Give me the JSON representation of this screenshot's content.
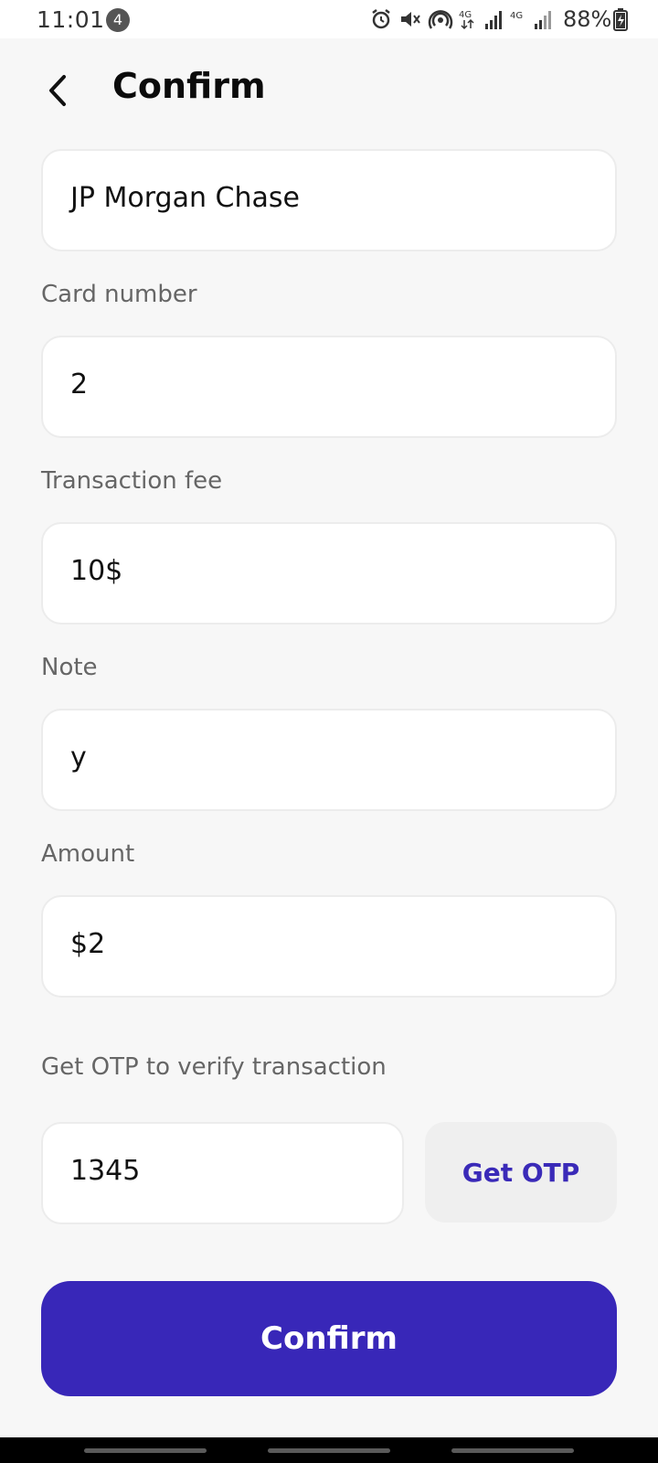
{
  "status_bar": {
    "time": "11:01",
    "notification_count": "4",
    "battery": "88%",
    "icons": [
      "alarm-icon",
      "mute-icon",
      "hotspot-icon",
      "4g-signal-icon",
      "signal-bars-icon",
      "4g-signal-icon",
      "signal-bars-icon",
      "battery-charging-icon"
    ]
  },
  "header": {
    "title": "Confirm",
    "back_icon": "chevron-left-icon"
  },
  "form": {
    "bank": {
      "value": "JP Morgan Chase"
    },
    "card_number": {
      "label": "Card number",
      "value": "2"
    },
    "transaction_fee": {
      "label": "Transaction fee",
      "value": "10$"
    },
    "note": {
      "label": "Note",
      "value": "y"
    },
    "amount": {
      "label": "Amount",
      "value": "$2"
    },
    "otp": {
      "label": "Get OTP to verify transaction",
      "value": "1345",
      "button_label": "Get OTP"
    }
  },
  "confirm_button": {
    "label": "Confirm"
  },
  "colors": {
    "accent": "#3827b8",
    "accent_text": "#3a2ab8",
    "background": "#f7f7f7"
  }
}
